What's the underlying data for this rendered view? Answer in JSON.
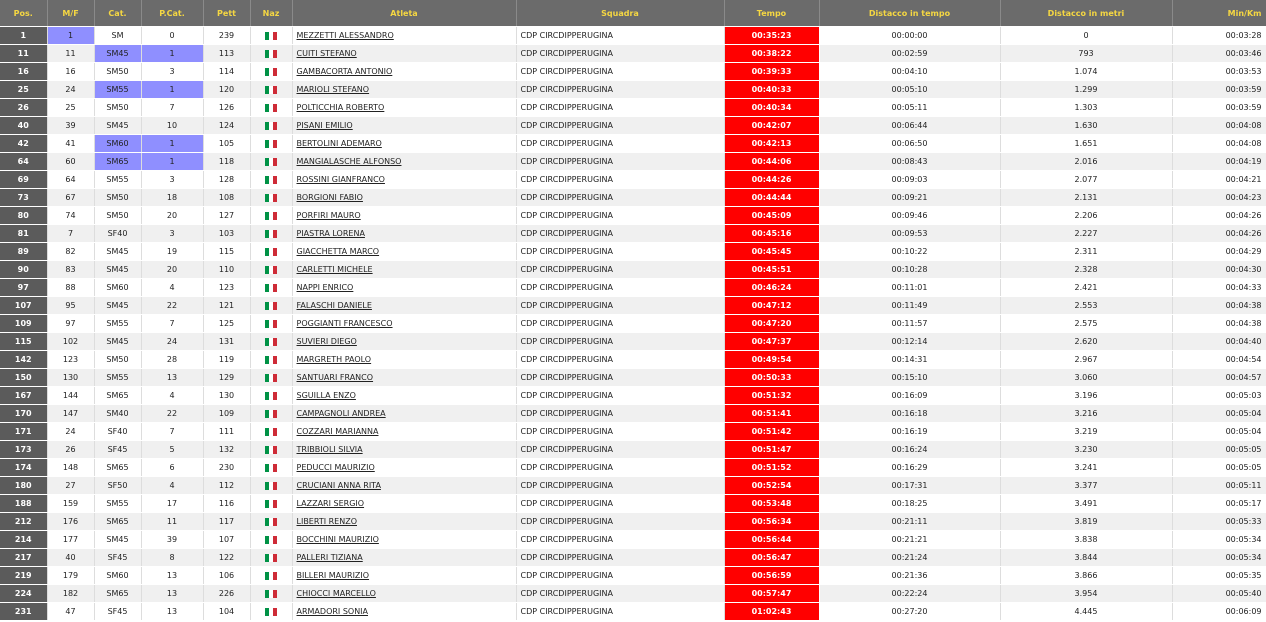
{
  "headers": {
    "pos": "Pos.",
    "mf": "M/F",
    "cat": "Cat.",
    "pcat": "P.Cat.",
    "pett": "Pett",
    "naz": "Naz",
    "atleta": "Atleta",
    "squadra": "Squadra",
    "tempo": "Tempo",
    "distacco_tempo": "Distacco in tempo",
    "distacco_metri": "Distacco in metri",
    "minkm": "Min/Km"
  },
  "colors": {
    "header_bg": "#6b6b6b",
    "header_text": "#f5d742",
    "highlight": "#8f8fff",
    "tempo_bg": "#ff0000"
  },
  "naz_icon": "italy-flag-icon",
  "rows": [
    {
      "pos": "1",
      "mf": "1",
      "cat": "SM",
      "pcat": "0",
      "pett": "239",
      "atleta": "MEZZETTI ALESSANDRO",
      "squadra": "CDP CIRCDIPPERUGINA",
      "tempo": "00:35:23",
      "dt": "00:00:00",
      "dm": "0",
      "mk": "00:03:28",
      "hl_mf": true,
      "hl_cat": false
    },
    {
      "pos": "11",
      "mf": "11",
      "cat": "SM45",
      "pcat": "1",
      "pett": "113",
      "atleta": "CUITI STEFANO",
      "squadra": "CDP CIRCDIPPERUGINA",
      "tempo": "00:38:22",
      "dt": "00:02:59",
      "dm": "793",
      "mk": "00:03:46",
      "hl_mf": false,
      "hl_cat": true
    },
    {
      "pos": "16",
      "mf": "16",
      "cat": "SM50",
      "pcat": "3",
      "pett": "114",
      "atleta": "GAMBACORTA ANTONIO",
      "squadra": "CDP CIRCDIPPERUGINA",
      "tempo": "00:39:33",
      "dt": "00:04:10",
      "dm": "1.074",
      "mk": "00:03:53",
      "hl_mf": false,
      "hl_cat": false
    },
    {
      "pos": "25",
      "mf": "24",
      "cat": "SM55",
      "pcat": "1",
      "pett": "120",
      "atleta": "MARIOLI STEFANO",
      "squadra": "CDP CIRCDIPPERUGINA",
      "tempo": "00:40:33",
      "dt": "00:05:10",
      "dm": "1.299",
      "mk": "00:03:59",
      "hl_mf": false,
      "hl_cat": true
    },
    {
      "pos": "26",
      "mf": "25",
      "cat": "SM50",
      "pcat": "7",
      "pett": "126",
      "atleta": "POLTICCHIA ROBERTO",
      "squadra": "CDP CIRCDIPPERUGINA",
      "tempo": "00:40:34",
      "dt": "00:05:11",
      "dm": "1.303",
      "mk": "00:03:59",
      "hl_mf": false,
      "hl_cat": false
    },
    {
      "pos": "40",
      "mf": "39",
      "cat": "SM45",
      "pcat": "10",
      "pett": "124",
      "atleta": "PISANI EMILIO",
      "squadra": "CDP CIRCDIPPERUGINA",
      "tempo": "00:42:07",
      "dt": "00:06:44",
      "dm": "1.630",
      "mk": "00:04:08",
      "hl_mf": false,
      "hl_cat": false
    },
    {
      "pos": "42",
      "mf": "41",
      "cat": "SM60",
      "pcat": "1",
      "pett": "105",
      "atleta": "BERTOLINI ADEMARO",
      "squadra": "CDP CIRCDIPPERUGINA",
      "tempo": "00:42:13",
      "dt": "00:06:50",
      "dm": "1.651",
      "mk": "00:04:08",
      "hl_mf": false,
      "hl_cat": true
    },
    {
      "pos": "64",
      "mf": "60",
      "cat": "SM65",
      "pcat": "1",
      "pett": "118",
      "atleta": "MANGIALASCHE ALFONSO",
      "squadra": "CDP CIRCDIPPERUGINA",
      "tempo": "00:44:06",
      "dt": "00:08:43",
      "dm": "2.016",
      "mk": "00:04:19",
      "hl_mf": false,
      "hl_cat": true
    },
    {
      "pos": "69",
      "mf": "64",
      "cat": "SM55",
      "pcat": "3",
      "pett": "128",
      "atleta": "ROSSINI GIANFRANCO",
      "squadra": "CDP CIRCDIPPERUGINA",
      "tempo": "00:44:26",
      "dt": "00:09:03",
      "dm": "2.077",
      "mk": "00:04:21",
      "hl_mf": false,
      "hl_cat": false
    },
    {
      "pos": "73",
      "mf": "67",
      "cat": "SM50",
      "pcat": "18",
      "pett": "108",
      "atleta": "BORGIONI FABIO",
      "squadra": "CDP CIRCDIPPERUGINA",
      "tempo": "00:44:44",
      "dt": "00:09:21",
      "dm": "2.131",
      "mk": "00:04:23",
      "hl_mf": false,
      "hl_cat": false
    },
    {
      "pos": "80",
      "mf": "74",
      "cat": "SM50",
      "pcat": "20",
      "pett": "127",
      "atleta": "PORFIRI MAURO",
      "squadra": "CDP CIRCDIPPERUGINA",
      "tempo": "00:45:09",
      "dt": "00:09:46",
      "dm": "2.206",
      "mk": "00:04:26",
      "hl_mf": false,
      "hl_cat": false
    },
    {
      "pos": "81",
      "mf": "7",
      "cat": "SF40",
      "pcat": "3",
      "pett": "103",
      "atleta": "PIASTRA LORENA",
      "squadra": "CDP CIRCDIPPERUGINA",
      "tempo": "00:45:16",
      "dt": "00:09:53",
      "dm": "2.227",
      "mk": "00:04:26",
      "hl_mf": false,
      "hl_cat": false
    },
    {
      "pos": "89",
      "mf": "82",
      "cat": "SM45",
      "pcat": "19",
      "pett": "115",
      "atleta": "GIACCHETTA MARCO",
      "squadra": "CDP CIRCDIPPERUGINA",
      "tempo": "00:45:45",
      "dt": "00:10:22",
      "dm": "2.311",
      "mk": "00:04:29",
      "hl_mf": false,
      "hl_cat": false
    },
    {
      "pos": "90",
      "mf": "83",
      "cat": "SM45",
      "pcat": "20",
      "pett": "110",
      "atleta": "CARLETTI MICHELE",
      "squadra": "CDP CIRCDIPPERUGINA",
      "tempo": "00:45:51",
      "dt": "00:10:28",
      "dm": "2.328",
      "mk": "00:04:30",
      "hl_mf": false,
      "hl_cat": false
    },
    {
      "pos": "97",
      "mf": "88",
      "cat": "SM60",
      "pcat": "4",
      "pett": "123",
      "atleta": "NAPPI ENRICO",
      "squadra": "CDP CIRCDIPPERUGINA",
      "tempo": "00:46:24",
      "dt": "00:11:01",
      "dm": "2.421",
      "mk": "00:04:33",
      "hl_mf": false,
      "hl_cat": false
    },
    {
      "pos": "107",
      "mf": "95",
      "cat": "SM45",
      "pcat": "22",
      "pett": "121",
      "atleta": "FALASCHI DANIELE",
      "squadra": "CDP CIRCDIPPERUGINA",
      "tempo": "00:47:12",
      "dt": "00:11:49",
      "dm": "2.553",
      "mk": "00:04:38",
      "hl_mf": false,
      "hl_cat": false
    },
    {
      "pos": "109",
      "mf": "97",
      "cat": "SM55",
      "pcat": "7",
      "pett": "125",
      "atleta": "POGGIANTI FRANCESCO",
      "squadra": "CDP CIRCDIPPERUGINA",
      "tempo": "00:47:20",
      "dt": "00:11:57",
      "dm": "2.575",
      "mk": "00:04:38",
      "hl_mf": false,
      "hl_cat": false
    },
    {
      "pos": "115",
      "mf": "102",
      "cat": "SM45",
      "pcat": "24",
      "pett": "131",
      "atleta": "SUVIERI DIEGO",
      "squadra": "CDP CIRCDIPPERUGINA",
      "tempo": "00:47:37",
      "dt": "00:12:14",
      "dm": "2.620",
      "mk": "00:04:40",
      "hl_mf": false,
      "hl_cat": false
    },
    {
      "pos": "142",
      "mf": "123",
      "cat": "SM50",
      "pcat": "28",
      "pett": "119",
      "atleta": "MARGRETH PAOLO",
      "squadra": "CDP CIRCDIPPERUGINA",
      "tempo": "00:49:54",
      "dt": "00:14:31",
      "dm": "2.967",
      "mk": "00:04:54",
      "hl_mf": false,
      "hl_cat": false
    },
    {
      "pos": "150",
      "mf": "130",
      "cat": "SM55",
      "pcat": "13",
      "pett": "129",
      "atleta": "SANTUARI FRANCO",
      "squadra": "CDP CIRCDIPPERUGINA",
      "tempo": "00:50:33",
      "dt": "00:15:10",
      "dm": "3.060",
      "mk": "00:04:57",
      "hl_mf": false,
      "hl_cat": false
    },
    {
      "pos": "167",
      "mf": "144",
      "cat": "SM65",
      "pcat": "4",
      "pett": "130",
      "atleta": "SGUILLA ENZO",
      "squadra": "CDP CIRCDIPPERUGINA",
      "tempo": "00:51:32",
      "dt": "00:16:09",
      "dm": "3.196",
      "mk": "00:05:03",
      "hl_mf": false,
      "hl_cat": false
    },
    {
      "pos": "170",
      "mf": "147",
      "cat": "SM40",
      "pcat": "22",
      "pett": "109",
      "atleta": "CAMPAGNOLI ANDREA",
      "squadra": "CDP CIRCDIPPERUGINA",
      "tempo": "00:51:41",
      "dt": "00:16:18",
      "dm": "3.216",
      "mk": "00:05:04",
      "hl_mf": false,
      "hl_cat": false
    },
    {
      "pos": "171",
      "mf": "24",
      "cat": "SF40",
      "pcat": "7",
      "pett": "111",
      "atleta": "COZZARI MARIANNA",
      "squadra": "CDP CIRCDIPPERUGINA",
      "tempo": "00:51:42",
      "dt": "00:16:19",
      "dm": "3.219",
      "mk": "00:05:04",
      "hl_mf": false,
      "hl_cat": false
    },
    {
      "pos": "173",
      "mf": "26",
      "cat": "SF45",
      "pcat": "5",
      "pett": "132",
      "atleta": "TRIBBIOLI SILVIA",
      "squadra": "CDP CIRCDIPPERUGINA",
      "tempo": "00:51:47",
      "dt": "00:16:24",
      "dm": "3.230",
      "mk": "00:05:05",
      "hl_mf": false,
      "hl_cat": false
    },
    {
      "pos": "174",
      "mf": "148",
      "cat": "SM65",
      "pcat": "6",
      "pett": "230",
      "atleta": "PEDUCCI MAURIZIO",
      "squadra": "CDP CIRCDIPPERUGINA",
      "tempo": "00:51:52",
      "dt": "00:16:29",
      "dm": "3.241",
      "mk": "00:05:05",
      "hl_mf": false,
      "hl_cat": false
    },
    {
      "pos": "180",
      "mf": "27",
      "cat": "SF50",
      "pcat": "4",
      "pett": "112",
      "atleta": "CRUCIANI ANNA RITA",
      "squadra": "CDP CIRCDIPPERUGINA",
      "tempo": "00:52:54",
      "dt": "00:17:31",
      "dm": "3.377",
      "mk": "00:05:11",
      "hl_mf": false,
      "hl_cat": false
    },
    {
      "pos": "188",
      "mf": "159",
      "cat": "SM55",
      "pcat": "17",
      "pett": "116",
      "atleta": "LAZZARI SERGIO",
      "squadra": "CDP CIRCDIPPERUGINA",
      "tempo": "00:53:48",
      "dt": "00:18:25",
      "dm": "3.491",
      "mk": "00:05:17",
      "hl_mf": false,
      "hl_cat": false
    },
    {
      "pos": "212",
      "mf": "176",
      "cat": "SM65",
      "pcat": "11",
      "pett": "117",
      "atleta": "LIBERTI RENZO",
      "squadra": "CDP CIRCDIPPERUGINA",
      "tempo": "00:56:34",
      "dt": "00:21:11",
      "dm": "3.819",
      "mk": "00:05:33",
      "hl_mf": false,
      "hl_cat": false
    },
    {
      "pos": "214",
      "mf": "177",
      "cat": "SM45",
      "pcat": "39",
      "pett": "107",
      "atleta": "BOCCHINI MAURIZIO",
      "squadra": "CDP CIRCDIPPERUGINA",
      "tempo": "00:56:44",
      "dt": "00:21:21",
      "dm": "3.838",
      "mk": "00:05:34",
      "hl_mf": false,
      "hl_cat": false
    },
    {
      "pos": "217",
      "mf": "40",
      "cat": "SF45",
      "pcat": "8",
      "pett": "122",
      "atleta": "PALLERI TIZIANA",
      "squadra": "CDP CIRCDIPPERUGINA",
      "tempo": "00:56:47",
      "dt": "00:21:24",
      "dm": "3.844",
      "mk": "00:05:34",
      "hl_mf": false,
      "hl_cat": false
    },
    {
      "pos": "219",
      "mf": "179",
      "cat": "SM60",
      "pcat": "13",
      "pett": "106",
      "atleta": "BILLERI MAURIZIO",
      "squadra": "CDP CIRCDIPPERUGINA",
      "tempo": "00:56:59",
      "dt": "00:21:36",
      "dm": "3.866",
      "mk": "00:05:35",
      "hl_mf": false,
      "hl_cat": false
    },
    {
      "pos": "224",
      "mf": "182",
      "cat": "SM65",
      "pcat": "13",
      "pett": "226",
      "atleta": "CHIOCCI MARCELLO",
      "squadra": "CDP CIRCDIPPERUGINA",
      "tempo": "00:57:47",
      "dt": "00:22:24",
      "dm": "3.954",
      "mk": "00:05:40",
      "hl_mf": false,
      "hl_cat": false
    },
    {
      "pos": "231",
      "mf": "47",
      "cat": "SF45",
      "pcat": "13",
      "pett": "104",
      "atleta": "ARMADORI SONIA",
      "squadra": "CDP CIRCDIPPERUGINA",
      "tempo": "01:02:43",
      "dt": "00:27:20",
      "dm": "4.445",
      "mk": "00:06:09",
      "hl_mf": false,
      "hl_cat": false
    }
  ]
}
